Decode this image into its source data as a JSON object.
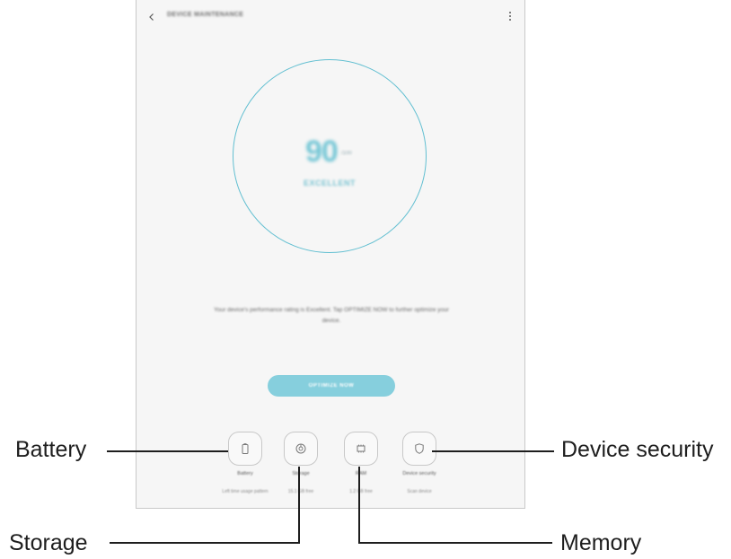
{
  "screen": {
    "title": "DEVICE MAINTENANCE",
    "icons": {
      "back": "back-arrow-icon",
      "more": "more-options-icon"
    }
  },
  "score": {
    "value": "90",
    "max": "/100",
    "status": "EXCELLENT"
  },
  "description": "Your device's performance rating is Excellent. Tap OPTIMIZE NOW to further optimize your device.",
  "optimize_button": "OPTIMIZE NOW",
  "tools": [
    {
      "label": "Battery",
      "sub": "Left time usage pattern",
      "icon": "battery-icon"
    },
    {
      "label": "Storage",
      "sub": "15.1 GB free",
      "icon": "storage-icon"
    },
    {
      "label": "RAM",
      "sub": "1.2 GB free",
      "icon": "memory-chip-icon"
    },
    {
      "label": "Device security",
      "sub": "Scan device",
      "icon": "shield-icon"
    }
  ],
  "callouts": {
    "battery": "Battery",
    "storage": "Storage",
    "memory": "Memory",
    "device_security": "Device security"
  },
  "colors": {
    "accent": "#62bfd1",
    "button": "#86cfdd",
    "background": "#f6f6f6"
  }
}
